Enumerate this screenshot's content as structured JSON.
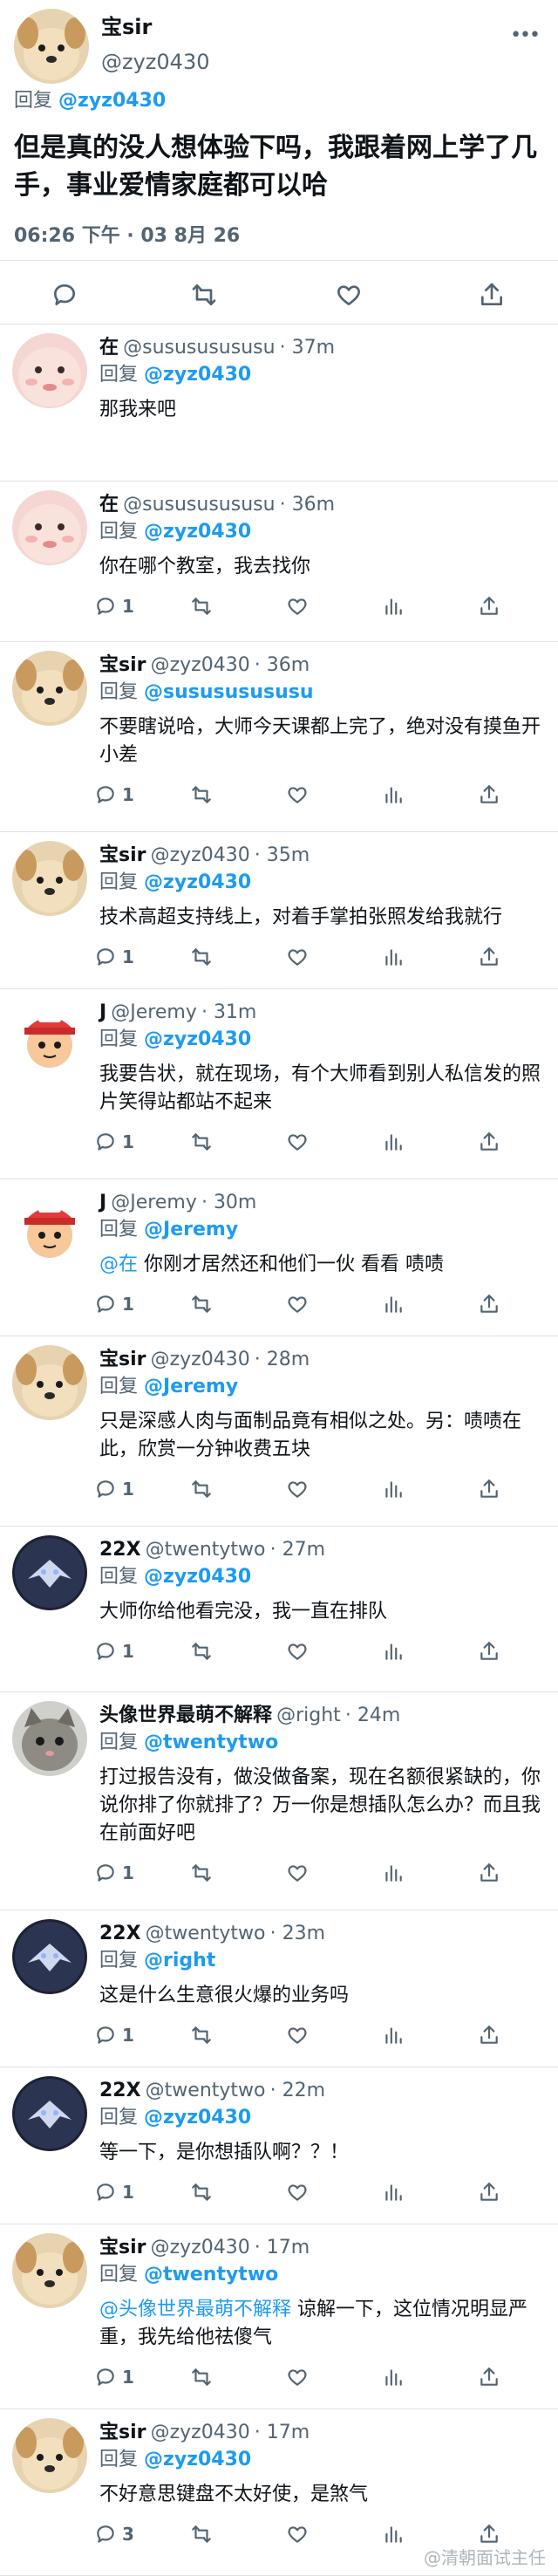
{
  "main": {
    "name": "宝sir",
    "handle": "@zyz0430",
    "reply_prefix": "回复",
    "reply_to": "@zyz0430",
    "text": "但是真的没人想体验下吗，我跟着网上学了几手，事业爱情家庭都可以哈",
    "timestamp": "06:26 下午 · 03 8月 26"
  },
  "icons": {
    "reply": "reply-icon",
    "retweet": "retweet-icon",
    "like": "heart-icon",
    "views": "views-icon",
    "share": "share-icon",
    "more": "more-icon"
  },
  "replies": [
    {
      "name": "在",
      "handle": "@susususususu",
      "time": "· 37m",
      "reply_to": "@zyz0430",
      "text": "那我来吧",
      "count": ""
    },
    {
      "name": "在",
      "handle": "@susususususu",
      "time": "· 36m",
      "reply_to": "@zyz0430",
      "text": "你在哪个教室，我去找你",
      "count": "1"
    },
    {
      "name": "宝sir",
      "handle": "@zyz0430",
      "time": "· 36m",
      "reply_to": "@susususususu",
      "text": "不要瞎说哈，大师今天课都上完了，绝对没有摸鱼开小差",
      "count": "1"
    },
    {
      "name": "宝sir",
      "handle": "@zyz0430",
      "time": "· 35m",
      "reply_to": "@zyz0430",
      "text": "技术高超支持线上，对着手掌拍张照发给我就行",
      "count": "1"
    },
    {
      "name": "J",
      "handle": "@Jeremy",
      "time": "· 31m",
      "reply_to": "@zyz0430",
      "text": "我要告状，就在现场，有个大师看到别人私信发的照片笑得站都站不起来",
      "count": "1"
    },
    {
      "name": "J",
      "handle": "@Jeremy",
      "time": "· 30m",
      "reply_to": "@Jeremy",
      "mention_inline": "@在",
      "text": " 你刚才居然还和他们一伙 看看 啧啧",
      "count": "1"
    },
    {
      "name": "宝sir",
      "handle": "@zyz0430",
      "time": "· 28m",
      "reply_to": "@Jeremy",
      "text": "只是深感人肉与面制品竟有相似之处。另：啧啧在此，欣赏一分钟收费五块",
      "count": "1"
    },
    {
      "name": "22X",
      "handle": "@twentytwo",
      "time": "· 27m",
      "reply_to": "@zyz0430",
      "text": "大师你给他看完没，我一直在排队",
      "count": "1"
    },
    {
      "name": "头像世界最萌不解释",
      "handle": "@right",
      "time": "· 24m",
      "reply_to": "@twentytwo",
      "text": "打过报告没有，做没做备案，现在名额很紧缺的，你说你排了你就排了？万一你是想插队怎么办？而且我在前面好吧",
      "count": "1"
    },
    {
      "name": "22X",
      "handle": "@twentytwo",
      "time": "· 23m",
      "reply_to": "@right",
      "text": "这是什么生意很火爆的业务吗",
      "count": "1"
    },
    {
      "name": "22X",
      "handle": "@twentytwo",
      "time": "· 22m",
      "reply_to": "@zyz0430",
      "text": "等一下，是你想插队啊？？！",
      "count": "1"
    },
    {
      "name": "宝sir",
      "handle": "@zyz0430",
      "time": "· 17m",
      "reply_to": "@twentytwo",
      "mention_inline": "@头像世界最萌不解释",
      "text": " 谅解一下，这位情况明显严重，我先给他祛傻气",
      "count": "1"
    },
    {
      "name": "宝sir",
      "handle": "@zyz0430",
      "time": "· 17m",
      "reply_to": "@zyz0430",
      "text": "不好意思键盘不太好使，是煞气",
      "count": "3"
    }
  ],
  "watermark": "@清朝面试主任",
  "colors": {
    "accent": "#1d9bf0",
    "muted": "#536471",
    "divider": "#dde3e8"
  }
}
